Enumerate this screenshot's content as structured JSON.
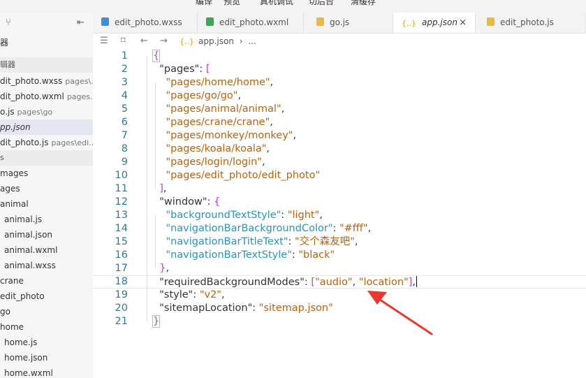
{
  "top_menu": [
    "编译",
    "预览",
    "真机调试",
    "切后台",
    "清缓存"
  ],
  "sidebar": {
    "rows": [
      {
        "name": "",
        "path": "",
        "type": "title",
        "label": "器"
      },
      {
        "name": "",
        "path": "",
        "type": "header",
        "label": "辑器"
      },
      {
        "name": "dit_photo.wxss",
        "path": "pages\\..."
      },
      {
        "name": "dit_photo.wxml",
        "path": "pages..."
      },
      {
        "name": "o.js",
        "path": "pages\\go"
      },
      {
        "name": "pp.json",
        "path": "",
        "active": true
      },
      {
        "name": "dit_photo.js",
        "path": "pages\\edi..."
      },
      {
        "name": "",
        "path": "",
        "type": "header",
        "label": "s"
      },
      {
        "name": "mages",
        "path": ""
      },
      {
        "name": "ages",
        "path": ""
      },
      {
        "name": "animal",
        "path": ""
      },
      {
        "name": "animal.js",
        "path": "",
        "indent": true
      },
      {
        "name": "animal.json",
        "path": "",
        "indent": true
      },
      {
        "name": "animal.wxml",
        "path": "",
        "indent": true
      },
      {
        "name": "animal.wxss",
        "path": "",
        "indent": true
      },
      {
        "name": "crane",
        "path": ""
      },
      {
        "name": "edit_photo",
        "path": ""
      },
      {
        "name": "go",
        "path": ""
      },
      {
        "name": "home",
        "path": ""
      },
      {
        "name": "home.js",
        "path": "",
        "indent": true
      },
      {
        "name": "home.json",
        "path": "",
        "indent": true
      },
      {
        "name": "home.wxml",
        "path": "",
        "indent": true
      }
    ]
  },
  "tabs": [
    {
      "label": "edit_photo.wxss",
      "icon": "css-file-icon"
    },
    {
      "label": "edit_photo.wxml",
      "icon": "wxml-file-icon"
    },
    {
      "label": "go.js",
      "icon": "js-file-icon"
    },
    {
      "label": "app.json",
      "icon": "json-file-icon",
      "active": true
    },
    {
      "label": "edit_photo.js",
      "icon": "js-file-icon"
    }
  ],
  "breadcrumb": {
    "file": "app.json",
    "sep": "›",
    "more": "..."
  },
  "code_lines": [
    {
      "n": "1",
      "t": [
        [
          "tok-brace-hl",
          "{"
        ]
      ]
    },
    {
      "n": "2",
      "t": [
        [
          "tok-punct",
          "  "
        ],
        [
          "tok-key",
          "\"pages\""
        ],
        [
          "tok-punct",
          ": "
        ],
        [
          "tok-brace",
          "["
        ]
      ]
    },
    {
      "n": "3",
      "t": [
        [
          "tok-punct",
          "    "
        ],
        [
          "tok-str",
          "\"pages/home/home\""
        ],
        [
          "tok-punct",
          ","
        ]
      ]
    },
    {
      "n": "4",
      "t": [
        [
          "tok-punct",
          "    "
        ],
        [
          "tok-str",
          "\"pages/go/go\""
        ],
        [
          "tok-punct",
          ","
        ]
      ]
    },
    {
      "n": "5",
      "t": [
        [
          "tok-punct",
          "    "
        ],
        [
          "tok-str",
          "\"pages/animal/animal\""
        ],
        [
          "tok-punct",
          ","
        ]
      ]
    },
    {
      "n": "6",
      "t": [
        [
          "tok-punct",
          "    "
        ],
        [
          "tok-str",
          "\"pages/crane/crane\""
        ],
        [
          "tok-punct",
          ","
        ]
      ]
    },
    {
      "n": "7",
      "t": [
        [
          "tok-punct",
          "    "
        ],
        [
          "tok-str",
          "\"pages/monkey/monkey\""
        ],
        [
          "tok-punct",
          ","
        ]
      ]
    },
    {
      "n": "8",
      "t": [
        [
          "tok-punct",
          "    "
        ],
        [
          "tok-str",
          "\"pages/koala/koala\""
        ],
        [
          "tok-punct",
          ","
        ]
      ]
    },
    {
      "n": "9",
      "t": [
        [
          "tok-punct",
          "    "
        ],
        [
          "tok-str",
          "\"pages/login/login\""
        ],
        [
          "tok-punct",
          ","
        ]
      ]
    },
    {
      "n": "10",
      "t": [
        [
          "tok-punct",
          "    "
        ],
        [
          "tok-str",
          "\"pages/edit_photo/edit_photo\""
        ]
      ]
    },
    {
      "n": "11",
      "t": [
        [
          "tok-punct",
          "  "
        ],
        [
          "tok-brace",
          "]"
        ],
        [
          "tok-punct",
          ","
        ]
      ]
    },
    {
      "n": "12",
      "t": [
        [
          "tok-punct",
          "  "
        ],
        [
          "tok-key",
          "\"window\""
        ],
        [
          "tok-punct",
          ": "
        ],
        [
          "tok-brace",
          "{"
        ]
      ]
    },
    {
      "n": "13",
      "t": [
        [
          "tok-punct",
          "    "
        ],
        [
          "tok-keyblue",
          "\"backgroundTextStyle\""
        ],
        [
          "tok-punct",
          ": "
        ],
        [
          "tok-str",
          "\"light\""
        ],
        [
          "tok-punct",
          ","
        ]
      ]
    },
    {
      "n": "14",
      "t": [
        [
          "tok-punct",
          "    "
        ],
        [
          "tok-keyblue",
          "\"navigationBarBackgroundColor\""
        ],
        [
          "tok-punct",
          ": "
        ],
        [
          "tok-str",
          "\"#fff\""
        ],
        [
          "tok-punct",
          ","
        ]
      ]
    },
    {
      "n": "15",
      "t": [
        [
          "tok-punct",
          "    "
        ],
        [
          "tok-keyblue",
          "\"navigationBarTitleText\""
        ],
        [
          "tok-punct",
          ": "
        ],
        [
          "tok-str",
          "\"交个森友吧\""
        ],
        [
          "tok-punct",
          ","
        ]
      ]
    },
    {
      "n": "16",
      "t": [
        [
          "tok-punct",
          "    "
        ],
        [
          "tok-keyblue",
          "\"navigationBarTextStyle\""
        ],
        [
          "tok-punct",
          ": "
        ],
        [
          "tok-str",
          "\"black\""
        ]
      ]
    },
    {
      "n": "17",
      "t": [
        [
          "tok-punct",
          "  "
        ],
        [
          "tok-brace",
          "}"
        ],
        [
          "tok-punct",
          ","
        ]
      ]
    },
    {
      "n": "18",
      "t": [
        [
          "tok-punct",
          "  "
        ],
        [
          "tok-key",
          "\"requiredBackgroundModes\""
        ],
        [
          "tok-punct",
          ": "
        ],
        [
          "tok-brace",
          "["
        ],
        [
          "tok-str",
          "\"audio\""
        ],
        [
          "tok-punct",
          ", "
        ],
        [
          "tok-str",
          "\"location\""
        ],
        [
          "tok-brace",
          "]"
        ],
        [
          "tok-punct",
          ","
        ]
      ],
      "current": true
    },
    {
      "n": "19",
      "t": [
        [
          "tok-punct",
          "  "
        ],
        [
          "tok-key",
          "\"style\""
        ],
        [
          "tok-punct",
          ": "
        ],
        [
          "tok-str",
          "\"v2\""
        ],
        [
          "tok-punct",
          ","
        ]
      ]
    },
    {
      "n": "20",
      "t": [
        [
          "tok-punct",
          "  "
        ],
        [
          "tok-key",
          "\"sitemapLocation\""
        ],
        [
          "tok-punct",
          ": "
        ],
        [
          "tok-str",
          "\"sitemap.json\""
        ]
      ]
    },
    {
      "n": "21",
      "t": [
        [
          "tok-brace-hl",
          "}"
        ]
      ]
    }
  ],
  "colors": {
    "arrow": "#e8392f",
    "brace": "#c23bd0",
    "string": "#b8620f",
    "key_blue": "#2795c0",
    "line_number": "#2b7a9b"
  },
  "icons": {
    "tab_close": "×",
    "back": "←",
    "forward": "→",
    "list": "☰",
    "bookmark": "⌑",
    "json_braces": "{..}"
  }
}
